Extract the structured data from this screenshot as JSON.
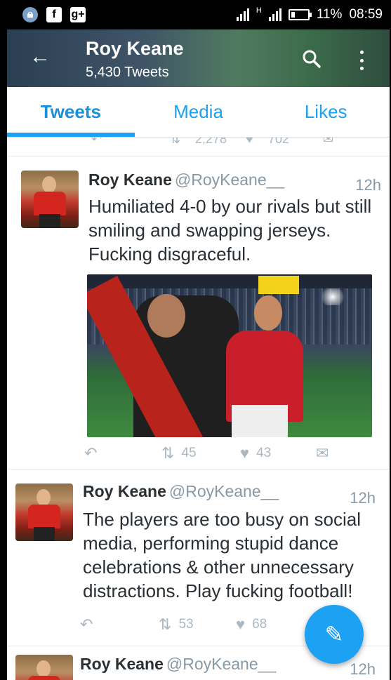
{
  "status_bar": {
    "battery": "11%",
    "time": "08:59",
    "signal_label": "H"
  },
  "header": {
    "title": "Roy Keane",
    "subtitle": "5,430 Tweets"
  },
  "tabs": [
    {
      "label": "Tweets",
      "active": true
    },
    {
      "label": "Media",
      "active": false
    },
    {
      "label": "Likes",
      "active": false
    }
  ],
  "previous_tweet_actions": {
    "retweets": "2,278",
    "likes": "702"
  },
  "tweets": [
    {
      "name": "Roy Keane",
      "handle": "@RoyKeane__",
      "time": "12h",
      "text": "Humiliated 4-0 by our rivals but still smiling and swapping jerseys. Fucking disgraceful.",
      "retweets": "45",
      "likes": "43"
    },
    {
      "name": "Roy Keane",
      "handle": "@RoyKeane__",
      "time": "12h",
      "text": "The players are too busy on social media, performing stupid dance celebrations & other unnecessary distractions. Play fucking football!",
      "retweets": "53",
      "likes": "68"
    },
    {
      "name": "Roy Keane",
      "handle": "@RoyKeane__",
      "time": "12h"
    }
  ],
  "icons": {
    "back": "arrow-left-icon",
    "search": "search-icon",
    "more": "more-vertical-icon",
    "reply": "reply-icon",
    "retweet": "retweet-icon",
    "like": "heart-icon",
    "dm": "envelope-icon",
    "compose": "compose-icon"
  },
  "colors": {
    "accent": "#1da1f2",
    "muted": "#aab8c2"
  }
}
